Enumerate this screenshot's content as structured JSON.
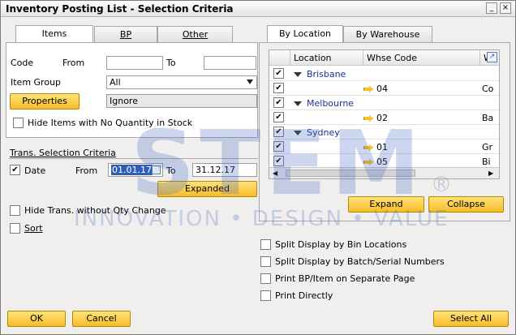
{
  "window": {
    "title": "Inventory Posting List - Selection Criteria",
    "minimize": "_",
    "close": "×"
  },
  "left_tabs": [
    {
      "label": "Items"
    },
    {
      "label": "BP"
    },
    {
      "label": "Other"
    }
  ],
  "items_panel": {
    "code_label": "Code",
    "from_label": "From",
    "to_label": "To",
    "code_from": "",
    "code_to": "",
    "item_group_label": "Item Group",
    "item_group_value": "All",
    "properties_button": "Properties",
    "properties_value": "Ignore",
    "hide_no_qty_label": "Hide Items with No Quantity in Stock"
  },
  "trans_section": {
    "heading": "Trans. Selection Criteria",
    "date_label": "Date",
    "from_label": "From",
    "date_from": "01.01.17",
    "to_label": "To",
    "date_to": "31.12.17",
    "expanded_button": "Expanded"
  },
  "options": {
    "hide_trans_label": "Hide Trans. without Qty Change",
    "sort_label": "Sort"
  },
  "right_tabs": [
    {
      "label": "By Location"
    },
    {
      "label": "By Warehouse"
    }
  ],
  "grid": {
    "headers": [
      "Location",
      "Whse Code",
      "W"
    ],
    "rows": [
      {
        "type": "group",
        "location": "Brisbane"
      },
      {
        "type": "item",
        "whse": "04",
        "name": "Co"
      },
      {
        "type": "group",
        "location": "Melbourne"
      },
      {
        "type": "item",
        "whse": "02",
        "name": "Ba"
      },
      {
        "type": "group",
        "location": "Sydney"
      },
      {
        "type": "item",
        "whse": "01",
        "name": "Gr"
      },
      {
        "type": "item",
        "whse": "05",
        "name": "Bi"
      }
    ],
    "expand_button": "Expand",
    "collapse_button": "Collapse"
  },
  "bottom_options": [
    {
      "label": "Split Display by Bin Locations"
    },
    {
      "label": "Split Display by Batch/Serial Numbers"
    },
    {
      "label": "Print BP/Item on Separate Page"
    },
    {
      "label": "Print Directly"
    }
  ],
  "footer": {
    "ok": "OK",
    "cancel": "Cancel",
    "select_all": "Select All"
  },
  "watermark": {
    "brand": "STEM",
    "tagline": "INNOVATION • DESIGN • VALUE",
    "reg": "®"
  },
  "colors": {
    "accent_yellow": "#f7bd2a",
    "link_blue": "#1a2f9a",
    "watermark": "#4a6fc8"
  }
}
